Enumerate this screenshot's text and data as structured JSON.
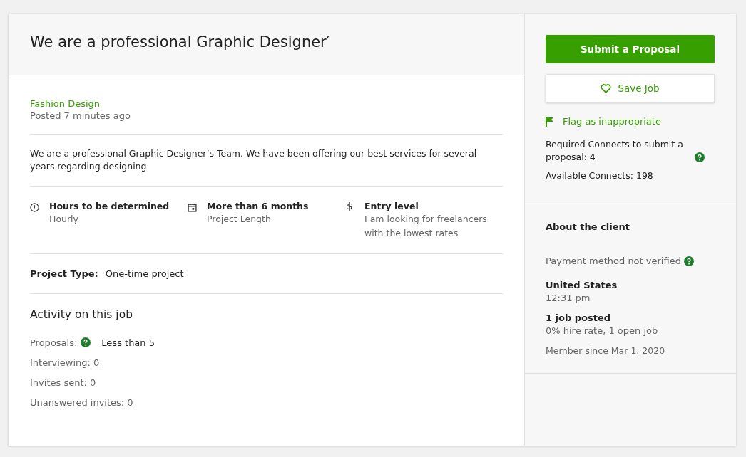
{
  "job": {
    "title": "We are a professional Graphic Designer′",
    "category": "Fashion Design",
    "posted": "Posted 7 minutes ago",
    "description": "We are a professional Graphic Designer’s Team. We have been offering our best services for several years regarding designing",
    "details": [
      {
        "kind": "clock",
        "title": "Hours to be determined",
        "subtitle": "Hourly"
      },
      {
        "kind": "calendar",
        "title": "More than 6 months",
        "subtitle": "Project Length"
      },
      {
        "kind": "symbol",
        "symbol": "$",
        "title": "Entry level",
        "subtitle": "I am looking for freelancers with the lowest rates"
      }
    ],
    "project_type": {
      "label": "Project Type:",
      "value": "One-time project"
    },
    "activity": {
      "title": "Activity on this job",
      "items": [
        {
          "label": "Proposals:",
          "help": true,
          "value": "Less than 5"
        },
        {
          "label": "Interviewing: 0",
          "help": false
        },
        {
          "label": "Invites sent: 0",
          "help": false
        },
        {
          "label": "Unanswered invites: 0",
          "help": false
        }
      ]
    }
  },
  "sidebar": {
    "submit_button": "Submit a Proposal",
    "save_button": "Save Job",
    "flag_link": "Flag as inappropriate",
    "connects": [
      {
        "text": "Required Connects to submit a proposal: 4",
        "help": true
      },
      {
        "text": "Available Connects: 198",
        "help": false
      }
    ],
    "client": {
      "title": "About the client",
      "payment": "Payment method not verified",
      "payment_help": true,
      "location": "United States",
      "time": "12:31 pm",
      "jobs": "1 job posted",
      "hire_rate": "0% hire rate, 1 open job",
      "member_since": "Member since Mar 1, 2020"
    }
  }
}
